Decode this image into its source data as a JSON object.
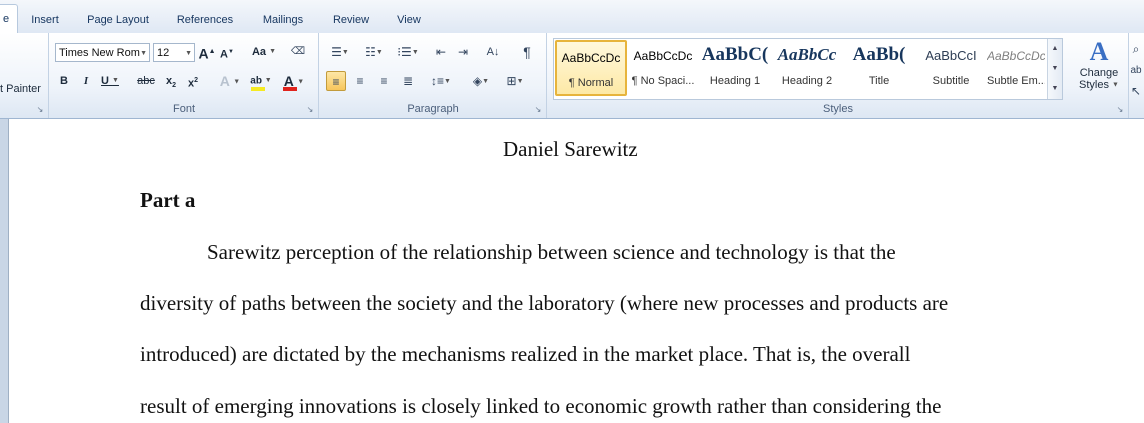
{
  "tabs": [
    {
      "label": "e",
      "active": true
    },
    {
      "label": "Insert"
    },
    {
      "label": "Page Layout"
    },
    {
      "label": "References"
    },
    {
      "label": "Mailings"
    },
    {
      "label": "Review"
    },
    {
      "label": "View"
    }
  ],
  "clipboard": {
    "format_painter": "t Painter"
  },
  "font": {
    "group_label": "Font",
    "font_name": "Times New Rom",
    "font_size": "12",
    "grow": "A",
    "shrink": "A",
    "change_case": "Aa",
    "bold": "B",
    "italic": "I",
    "underline": "U",
    "strike": "abc",
    "subscript": "x",
    "superscript": "x",
    "font_color_letter": "A",
    "highlight_letter": "ab",
    "effects_letter": "A"
  },
  "paragraph": {
    "group_label": "Paragraph"
  },
  "styles": {
    "group_label": "Styles",
    "items": [
      {
        "sample": "AaBbCcDc",
        "name": "¶ Normal",
        "selected": true
      },
      {
        "sample": "AaBbCcDc",
        "name": "¶ No Spaci..."
      },
      {
        "sample": "AaBbC(",
        "name": "Heading 1"
      },
      {
        "sample": "AaBbCc",
        "name": "Heading 2"
      },
      {
        "sample": "AaBb(",
        "name": "Title"
      },
      {
        "sample": "AaBbCcI",
        "name": "Subtitle"
      },
      {
        "sample": "AaBbCcDc",
        "name": "Subtle Em..."
      }
    ],
    "change_styles_line1": "Change",
    "change_styles_line2": "Styles"
  },
  "colors": {
    "font_color": "#e0231d",
    "highlight": "#f5ea23",
    "accent": "#f7c65c"
  },
  "document": {
    "heading": "Daniel Sarewitz",
    "part": "Part a",
    "lines": [
      "Sarewitz perception of the relationship between science and technology is that the",
      "diversity of paths between the society and the laboratory (where new processes and products are",
      "introduced) are dictated by the mechanisms realized in the market place. That is, the overall",
      "result of emerging innovations is closely linked to economic growth rather than considering the"
    ]
  }
}
